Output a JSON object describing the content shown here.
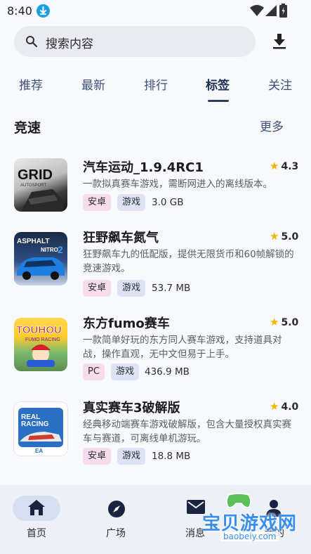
{
  "status_bar": {
    "time": "8:40"
  },
  "search": {
    "placeholder": "搜索内容"
  },
  "tabs": [
    {
      "label": "推荐"
    },
    {
      "label": "最新"
    },
    {
      "label": "排行"
    },
    {
      "label": "标签",
      "active": true
    },
    {
      "label": "关注"
    }
  ],
  "section": {
    "title": "竞速",
    "more_label": "更多"
  },
  "items": [
    {
      "title": "汽车运动_1.9.4RC1",
      "rating": "4.3",
      "description": "一款拟真赛车游戏，需断网进入的离线版本。",
      "platform": "安卓",
      "type": "游戏",
      "size": "3.0 GB",
      "icon_name": "grid-autosport-game-icon",
      "icon_text": "GRID"
    },
    {
      "title": "狂野飙车氮气",
      "rating": "5.0",
      "description": "狂野飙车九的低配版，提供无限货币和60帧解锁的竞速游戏。",
      "platform": "安卓",
      "type": "游戏",
      "size": "53.7 MB",
      "icon_name": "asphalt-nitro-game-icon",
      "icon_text": "ASPHALT NITRO 2"
    },
    {
      "title": "东方fumo赛车",
      "rating": "5.0",
      "description": "一款简单好玩的东方同人赛车游戏，支持道具对战，操作直观，无中文但易于上手。",
      "platform": "PC",
      "type": "游戏",
      "size": "436.9 MB",
      "icon_name": "touhou-fumo-racing-game-icon",
      "icon_text": "TOUHOU"
    },
    {
      "title": "真实赛车3破解版",
      "rating": "4.0",
      "description": "经典移动端赛车游戏破解版，包含大量授权真实赛车与赛道，可离线单机游玩。",
      "platform": "安卓",
      "type": "游戏",
      "size": "18.8 MB",
      "icon_name": "real-racing-game-icon",
      "icon_text": "REAL RACING"
    }
  ],
  "bottom_nav": [
    {
      "label": "首页",
      "icon": "home-icon",
      "active": true
    },
    {
      "label": "广场",
      "icon": "compass-icon"
    },
    {
      "label": "消息",
      "icon": "mail-icon"
    },
    {
      "label": "我的",
      "icon": "person-icon"
    }
  ],
  "watermark": {
    "text": "宝贝游戏网",
    "url": "baobeiy.com"
  },
  "colors": {
    "accent": "#2c3e66",
    "star": "#f0b400",
    "platform_tag": "#f7dcec",
    "type_tag": "#dde3f4"
  }
}
